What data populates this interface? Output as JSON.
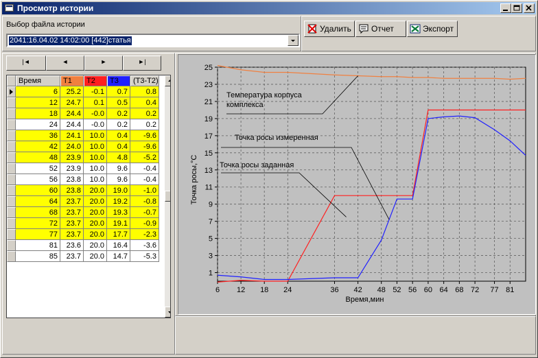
{
  "window": {
    "title": "Просмотр истории"
  },
  "file_label": "Выбор файла истории",
  "file_value": "2041:16.04.02 14:02:00 [442]статья",
  "actions": {
    "delete": "Удалить",
    "report": "Отчет",
    "export": "Экспорт"
  },
  "nav": {
    "first": "|◄",
    "prev": "◄",
    "next": "►",
    "last": "►|"
  },
  "table": {
    "columns": [
      "Время",
      "T1",
      "T2",
      "T3",
      "(T3-T2)"
    ],
    "header_colors": [
      "#d4d0c8",
      "#f08040",
      "#ff2020",
      "#2020ff",
      "#d4d0c8"
    ],
    "rows": [
      {
        "cells": [
          "6",
          "25.2",
          "-0.1",
          "0.7",
          "0.8"
        ],
        "highlight": true
      },
      {
        "cells": [
          "12",
          "24.7",
          "0.1",
          "0.5",
          "0.4"
        ],
        "highlight": true
      },
      {
        "cells": [
          "18",
          "24.4",
          "-0.0",
          "0.2",
          "0.2"
        ],
        "highlight": true
      },
      {
        "cells": [
          "24",
          "24.4",
          "-0.0",
          "0.2",
          "0.2"
        ],
        "highlight": false
      },
      {
        "cells": [
          "36",
          "24.1",
          "10.0",
          "0.4",
          "-9.6"
        ],
        "highlight": true
      },
      {
        "cells": [
          "42",
          "24.0",
          "10.0",
          "0.4",
          "-9.6"
        ],
        "highlight": true
      },
      {
        "cells": [
          "48",
          "23.9",
          "10.0",
          "4.8",
          "-5.2"
        ],
        "highlight": true
      },
      {
        "cells": [
          "52",
          "23.9",
          "10.0",
          "9.6",
          "-0.4"
        ],
        "highlight": false
      },
      {
        "cells": [
          "56",
          "23.8",
          "10.0",
          "9.6",
          "-0.4"
        ],
        "highlight": false
      },
      {
        "cells": [
          "60",
          "23.8",
          "20.0",
          "19.0",
          "-1.0"
        ],
        "highlight": true
      },
      {
        "cells": [
          "64",
          "23.7",
          "20.0",
          "19.2",
          "-0.8"
        ],
        "highlight": true
      },
      {
        "cells": [
          "68",
          "23.7",
          "20.0",
          "19.3",
          "-0.7"
        ],
        "highlight": true
      },
      {
        "cells": [
          "72",
          "23.7",
          "20.0",
          "19.1",
          "-0.9"
        ],
        "highlight": true
      },
      {
        "cells": [
          "77",
          "23.7",
          "20.0",
          "17.7",
          "-2.3"
        ],
        "highlight": true
      },
      {
        "cells": [
          "81",
          "23.6",
          "20.0",
          "16.4",
          "-3.6"
        ],
        "highlight": false
      },
      {
        "cells": [
          "85",
          "23.7",
          "20.0",
          "14.7",
          "-5.3"
        ],
        "highlight": false
      }
    ]
  },
  "chart_data": {
    "type": "line",
    "xlabel": "Время,мин",
    "ylabel": "Точка росы,°C",
    "xlim": [
      6,
      85
    ],
    "ylim": [
      0,
      25
    ],
    "xticks": [
      6,
      12,
      18,
      24,
      36,
      42,
      48,
      52,
      56,
      60,
      64,
      68,
      72,
      77,
      81
    ],
    "yticks": [
      1,
      3,
      5,
      7,
      9,
      11,
      13,
      15,
      17,
      19,
      21,
      23,
      25
    ],
    "grid": true,
    "x": [
      6,
      12,
      18,
      24,
      36,
      42,
      48,
      52,
      56,
      60,
      64,
      68,
      72,
      77,
      81,
      85
    ],
    "series": [
      {
        "name": "Температура корпуса комплекса",
        "color": "#f08040",
        "values": [
          25.2,
          24.7,
          24.4,
          24.4,
          24.1,
          24.0,
          23.9,
          23.9,
          23.8,
          23.8,
          23.7,
          23.7,
          23.7,
          23.7,
          23.6,
          23.7
        ]
      },
      {
        "name": "Точка росы заданная",
        "color": "#ff2020",
        "values": [
          -0.1,
          0.1,
          -0.0,
          -0.0,
          10.0,
          10.0,
          10.0,
          10.0,
          10.0,
          20.0,
          20.0,
          20.0,
          20.0,
          20.0,
          20.0,
          20.0
        ]
      },
      {
        "name": "Точка росы измеренная",
        "color": "#2020ff",
        "values": [
          0.7,
          0.5,
          0.2,
          0.2,
          0.4,
          0.4,
          4.8,
          9.6,
          9.6,
          19.0,
          19.2,
          19.3,
          19.1,
          17.7,
          16.4,
          14.7
        ]
      }
    ],
    "annotations": [
      {
        "text": "Температура корпуса",
        "text2": "комплекса",
        "series": 0
      },
      {
        "text": "Точка росы измеренная",
        "series": 2
      },
      {
        "text": "Точка росы заданная",
        "series": 1
      }
    ]
  }
}
